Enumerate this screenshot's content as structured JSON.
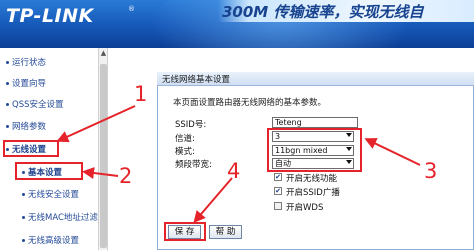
{
  "banner": {
    "logo": "TP-LINK",
    "logo_mark": "®",
    "tagline": "300M 传输速率，实现无线自"
  },
  "sidebar": {
    "items": [
      {
        "label": "运行状态"
      },
      {
        "label": "设置向导"
      },
      {
        "label": "QSS安全设置"
      },
      {
        "label": "网络参数"
      },
      {
        "label": "无线设置"
      },
      {
        "label": "基本设置"
      },
      {
        "label": "无线安全设置"
      },
      {
        "label": "无线MAC地址过滤"
      },
      {
        "label": "无线高级设置"
      }
    ]
  },
  "panel": {
    "title": "无线网络基本设置",
    "description": "本页面设置路由器无线网络的基本参数。",
    "fields": {
      "ssid_label": "SSID号:",
      "ssid_value": "Teteng",
      "channel_label": "信道:",
      "channel_value": "3",
      "mode_label": "模式:",
      "mode_value": "11bgn mixed",
      "bandwidth_label": "频段带宽:",
      "bandwidth_value": "自动"
    },
    "checks": {
      "wireless_label": "开启无线功能",
      "wireless_checked": true,
      "ssid_broadcast_label": "开启SSID广播",
      "ssid_broadcast_checked": true,
      "wds_label": "开启WDS",
      "wds_checked": false
    },
    "buttons": {
      "save": "保 存",
      "help": "帮 助"
    }
  },
  "annotations": {
    "color": "#e4242a",
    "labels": [
      "1",
      "2",
      "3",
      "4"
    ]
  }
}
